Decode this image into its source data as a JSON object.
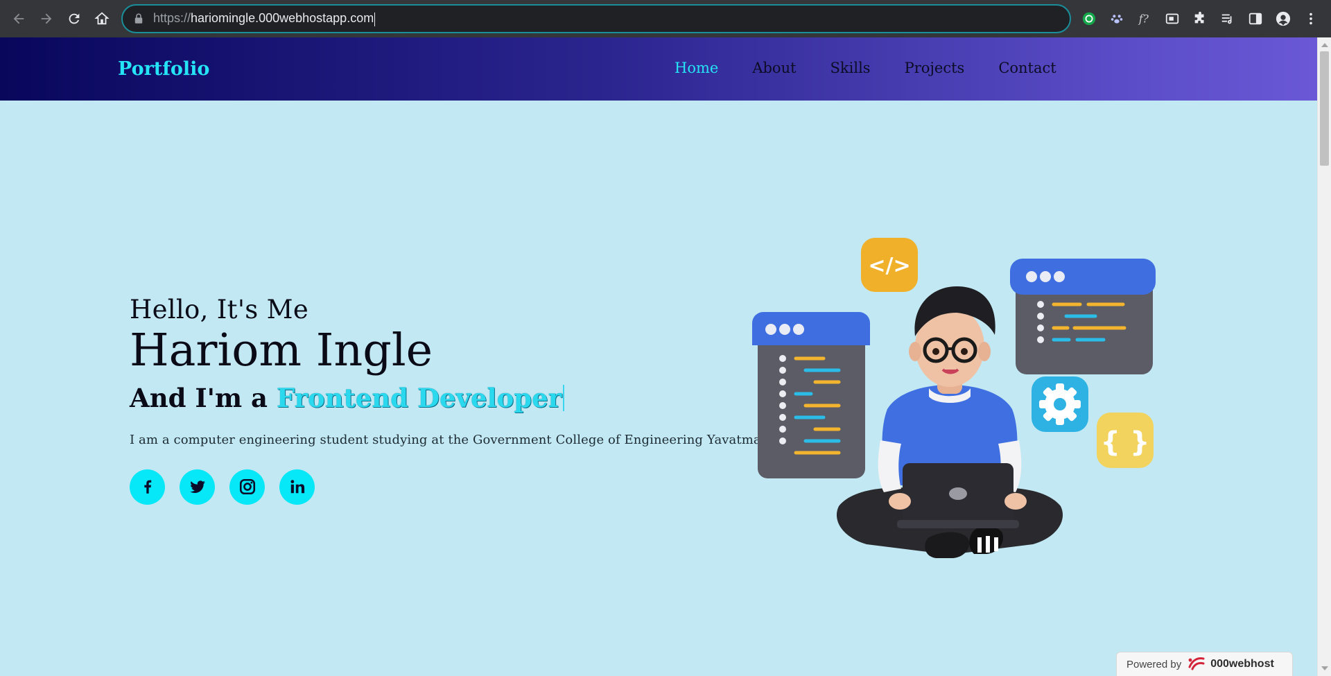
{
  "browser": {
    "url_scheme": "https://",
    "url_host": "hariomingle.000webhostapp.com",
    "icons": {
      "back": "back-arrow-icon",
      "forward": "forward-arrow-icon",
      "reload": "reload-icon",
      "home": "home-icon",
      "lock": "lock-icon",
      "extensions": [
        "grammarly-icon",
        "paw-icon",
        "function-icon",
        "screenshot-icon",
        "puzzle-icon",
        "reading-list-icon",
        "side-panel-icon",
        "profile-icon",
        "kebab-menu-icon"
      ]
    }
  },
  "site": {
    "logo": "Portfolio",
    "nav": [
      {
        "label": "Home",
        "active": true
      },
      {
        "label": "About",
        "active": false
      },
      {
        "label": "Skills",
        "active": false
      },
      {
        "label": "Projects",
        "active": false
      },
      {
        "label": "Contact",
        "active": false
      }
    ],
    "colors": {
      "accent": "#25e4f6",
      "background": "#c2e9f3",
      "header_start": "#08075c",
      "header_end": "#6a58d6"
    }
  },
  "hero": {
    "greeting": "Hello, It's Me",
    "name": "Hariom Ingle",
    "role_prefix": "And I'm a",
    "role": "Frontend Developer",
    "bio": "I am a computer engineering student studying at the Government College of Engineering Yavatmal.",
    "socials": [
      {
        "icon": "facebook-icon"
      },
      {
        "icon": "twitter-icon"
      },
      {
        "icon": "instagram-icon"
      },
      {
        "icon": "linkedin-icon"
      }
    ],
    "illustration": "developer-with-laptop-illustration"
  },
  "badge": {
    "label": "Powered by",
    "brand": "000webhost"
  }
}
